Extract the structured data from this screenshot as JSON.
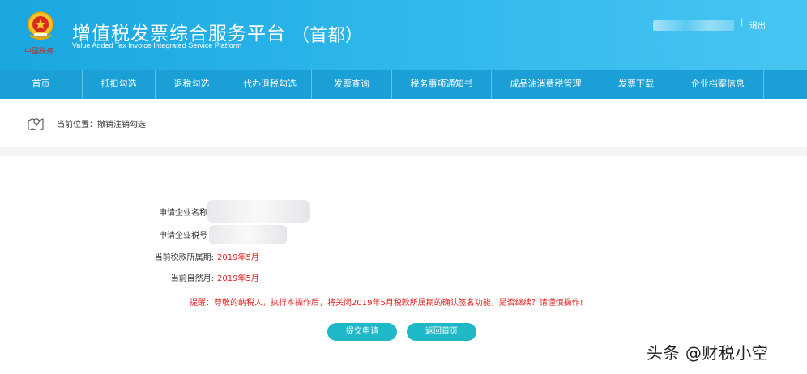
{
  "header": {
    "title_cn": "增值税发票综合服务平台",
    "region": "（首都）",
    "title_en": "Value Added Tax Invoice Integrated Service Platform",
    "emblem_caption": "中国税务",
    "separator": "|",
    "logout_label": "退出"
  },
  "nav": {
    "items": [
      {
        "label": "首页"
      },
      {
        "label": "抵扣勾选"
      },
      {
        "label": "退税勾选"
      },
      {
        "label": "代办退税勾选"
      },
      {
        "label": "发票查询"
      },
      {
        "label": "税务事项通知书"
      },
      {
        "label": "成品油消费税管理"
      },
      {
        "label": "发票下载"
      },
      {
        "label": "企业档案信息"
      }
    ]
  },
  "breadcrumb": {
    "label": "当前位置：",
    "current": "撤销注销勾选"
  },
  "form": {
    "company_name_label": "申请企业名称",
    "tax_id_label": "申请企业税号",
    "tax_period_label": "当前税款所属期:",
    "tax_period_value": "2019年5月",
    "natural_month_label": "当前自然月:",
    "natural_month_value": "2019年5月"
  },
  "warning_text": "提醒：尊敬的纳税人，执行本操作后，将关闭2019年5月税款所属期的确认签名功能，是否继续？请谨慎操作!",
  "buttons": {
    "submit_label": "提交申请",
    "home_label": "返回首页"
  },
  "watermark": "头条 @财税小空",
  "colors": {
    "header_start": "#1aa6df",
    "nav_bg": "#1a9fd6",
    "button_bg": "#1fb8c7",
    "warning_red": "#e02020"
  }
}
